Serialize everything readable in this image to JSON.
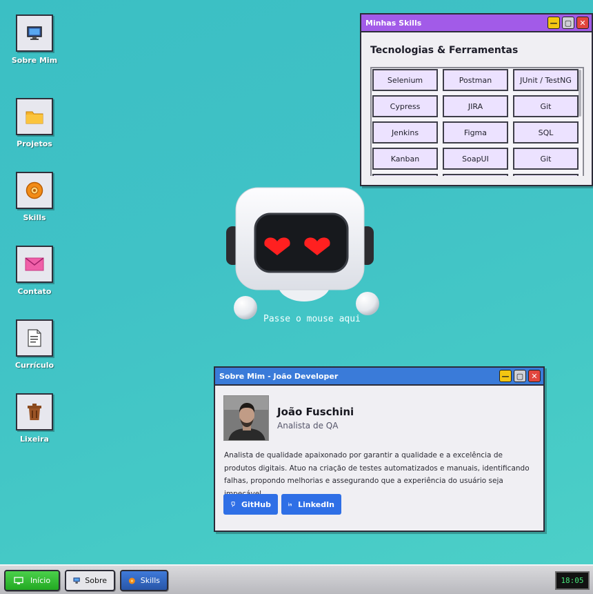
{
  "desktop": {
    "icons": [
      {
        "label": "Sobre Mim",
        "icon": "monitor-icon"
      },
      {
        "label": "Projetos",
        "icon": "folder-icon"
      },
      {
        "label": "Skills",
        "icon": "disc-icon"
      },
      {
        "label": "Contato",
        "icon": "envelope-icon"
      },
      {
        "label": "Currículo",
        "icon": "document-icon"
      },
      {
        "label": "Lixeira",
        "icon": "trash-icon"
      }
    ]
  },
  "skills_window": {
    "title": "Minhas Skills",
    "heading": "Tecnologias & Ferramentas",
    "skills": [
      "Selenium",
      "Postman",
      "JUnit / TestNG",
      "Cypress",
      "JIRA",
      "Git",
      "Jenkins",
      "Figma",
      "SQL",
      "Kanban",
      "SoapUI",
      "Git"
    ],
    "accent": "#a25be8"
  },
  "robot": {
    "hint": "Passe o mouse aqui"
  },
  "about_window": {
    "title": "Sobre Mim - João Developer",
    "name": "João Fuschini",
    "role": "Analista de QA",
    "bio": "Analista de qualidade apaixonado por garantir a qualidade e a excelência de produtos digitais. Atuo na criação de testes automatizados e manuais, identificando falhas, propondo melhorias e assegurando que a experiência do usuário seja impecável.",
    "buttons": {
      "github": "GitHub",
      "linkedin": "LinkedIn"
    },
    "accent": "#3a7bd9"
  },
  "taskbar": {
    "start_label": "Início",
    "tasks": [
      {
        "label": "Sobre",
        "icon": "monitor-icon"
      },
      {
        "label": "Skills",
        "icon": "disc-icon"
      }
    ],
    "clock": "18:05"
  },
  "window_controls": {
    "minimize": "—",
    "maximize": "▢",
    "close": "✕"
  }
}
